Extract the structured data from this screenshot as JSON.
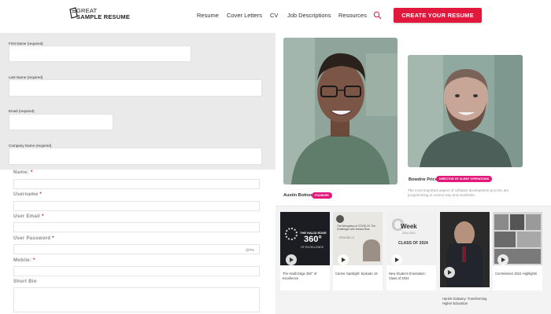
{
  "header": {
    "logo_line1": "GREAT",
    "logo_line2": "SAMPLE RESUME",
    "nav": [
      "Resume",
      "Cover Letters",
      "CV",
      "Job Descriptions",
      "Resources"
    ],
    "cta": "CREATE YOUR RESUME"
  },
  "form_top": {
    "first_name": "First Name (required)",
    "last_name": "Last Name (required)",
    "email": "Email (required)",
    "company": "Company Name (required)"
  },
  "form_bottom": {
    "name": "Name:",
    "username": "Username",
    "email": "User Email",
    "password": "User Password",
    "mobile": "Mobile:",
    "bio": "Short Bio",
    "required_mark": "*",
    "password_toggle": "@#%"
  },
  "team": [
    {
      "name": "Austin Botton",
      "badge": "FOUNDER"
    },
    {
      "name": "Bowdrie Price",
      "badge": "DIRECTOR OF CLIENT OPERATIONS",
      "desc": "The most important aspect of software development process are programming in correct way and manifests."
    }
  ],
  "videos": [
    {
      "title": "The Haldi Edge 360° of Excellence",
      "thumb_top": "THE HALDI EDGE",
      "thumb_big": "360°",
      "thumb_bot": "OF EXCELLENCE"
    },
    {
      "title": "Career Spotlight: Episode 19",
      "thumb_top": "The Wrongness of COVID-19: The Challenges with Jessica Bras",
      "thumb_mid": "EPISODE 19"
    },
    {
      "title": "New Student Orientation: Class of 2024",
      "thumb_big": "Week",
      "thumb_year": "2024 2020",
      "thumb_bot": "CLASS OF 2024"
    },
    {
      "title": "Harish Gidwany: Transforming Higher Education"
    },
    {
      "title": "Commission 2024 Highlights"
    }
  ],
  "colors": {
    "accent": "#e2173c",
    "badge": "#e2187a"
  }
}
